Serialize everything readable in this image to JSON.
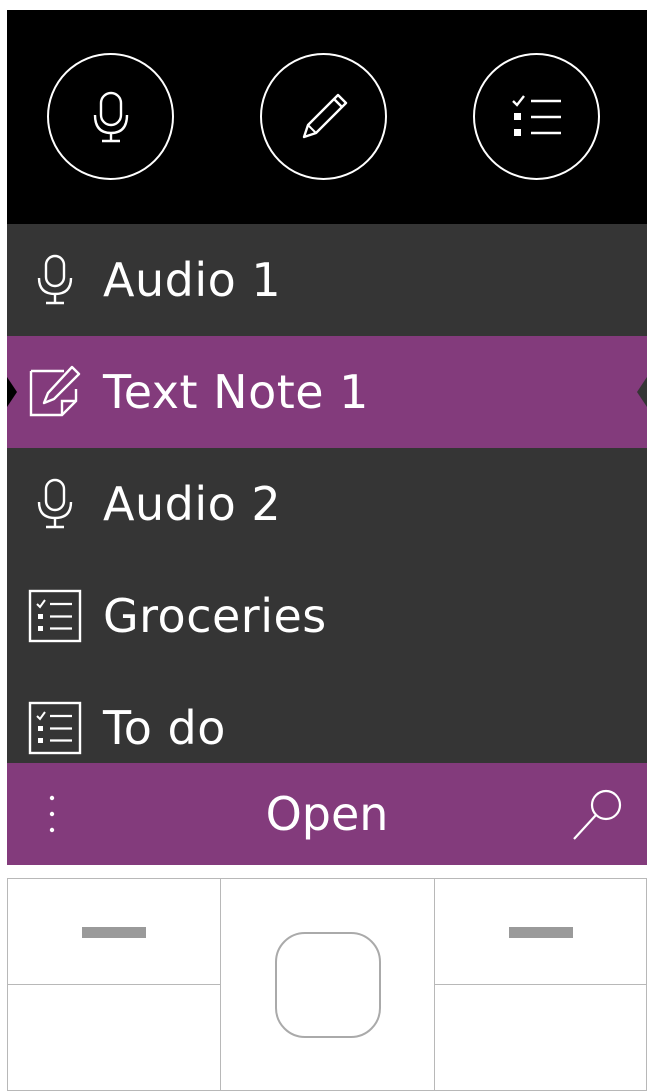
{
  "quick_actions": [
    {
      "icon": "microphone-icon"
    },
    {
      "icon": "pencil-icon"
    },
    {
      "icon": "checklist-icon"
    }
  ],
  "notes": [
    {
      "label": "Audio 1",
      "icon": "microphone-icon",
      "selected": false
    },
    {
      "label": "Text Note 1",
      "icon": "edit-note-icon",
      "selected": true
    },
    {
      "label": "Audio 2",
      "icon": "microphone-icon",
      "selected": false
    },
    {
      "label": "Groceries",
      "icon": "checklist-icon",
      "selected": false
    },
    {
      "label": "To do",
      "icon": "checklist-icon",
      "selected": false
    }
  ],
  "appbar": {
    "center_label": "Open",
    "more_icon": "more-vertical-icon",
    "search_icon": "search-icon"
  },
  "colors": {
    "accent": "#833b7c",
    "list_bg": "#353535",
    "topbar_bg": "#000000"
  }
}
